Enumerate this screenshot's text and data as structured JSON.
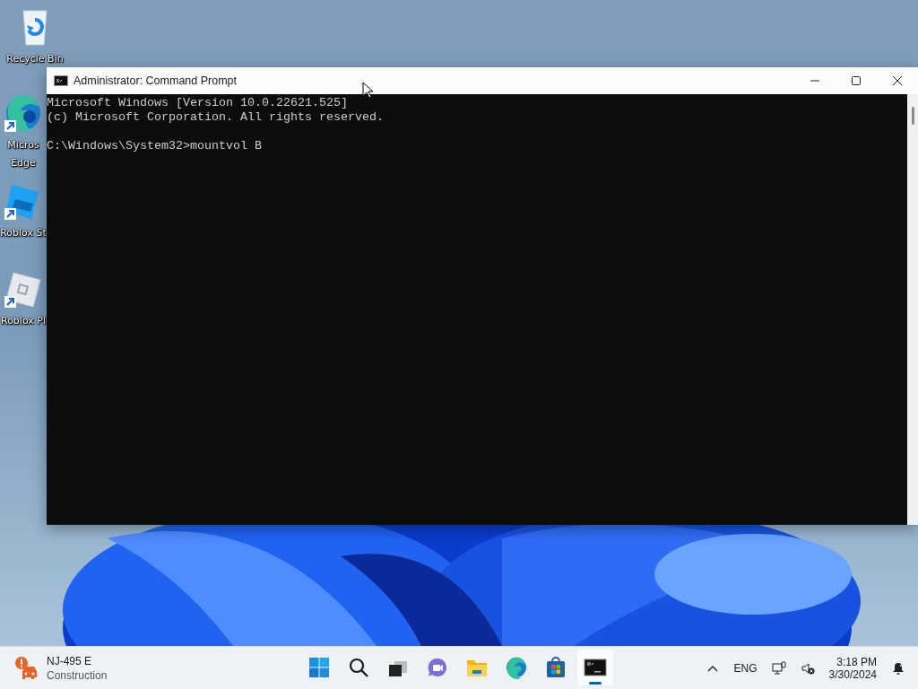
{
  "desktop": {
    "icons": [
      {
        "kind": "recycle-bin",
        "shortcut": false,
        "lines": [
          "Recycle Bin"
        ]
      },
      {
        "kind": "edge",
        "shortcut": true,
        "lines": [
          "Micros",
          "Edge"
        ]
      },
      {
        "kind": "roblox-studio",
        "shortcut": true,
        "lines": [
          "Roblox St"
        ]
      },
      {
        "kind": "roblox-player",
        "shortcut": true,
        "lines": [
          "Roblox Pl"
        ]
      }
    ]
  },
  "window": {
    "title": "Administrator: Command Prompt",
    "output": [
      "Microsoft Windows [Version 10.0.22621.525]",
      "(c) Microsoft Corporation. All rights reserved."
    ],
    "prompt": "C:\\Windows\\System32>mountvol B"
  },
  "taskbar": {
    "widget": {
      "title": "NJ-495 E",
      "subtitle": "Construction"
    },
    "apps": [
      {
        "kind": "start",
        "active": false
      },
      {
        "kind": "search",
        "active": false
      },
      {
        "kind": "task-view",
        "active": false
      },
      {
        "kind": "chat",
        "active": false
      },
      {
        "kind": "explorer",
        "active": false
      },
      {
        "kind": "edge",
        "active": false
      },
      {
        "kind": "store",
        "active": false
      },
      {
        "kind": "terminal",
        "active": true
      }
    ],
    "tray": {
      "language": "ENG",
      "time": "3:18 PM",
      "date": "3/30/2024"
    }
  }
}
